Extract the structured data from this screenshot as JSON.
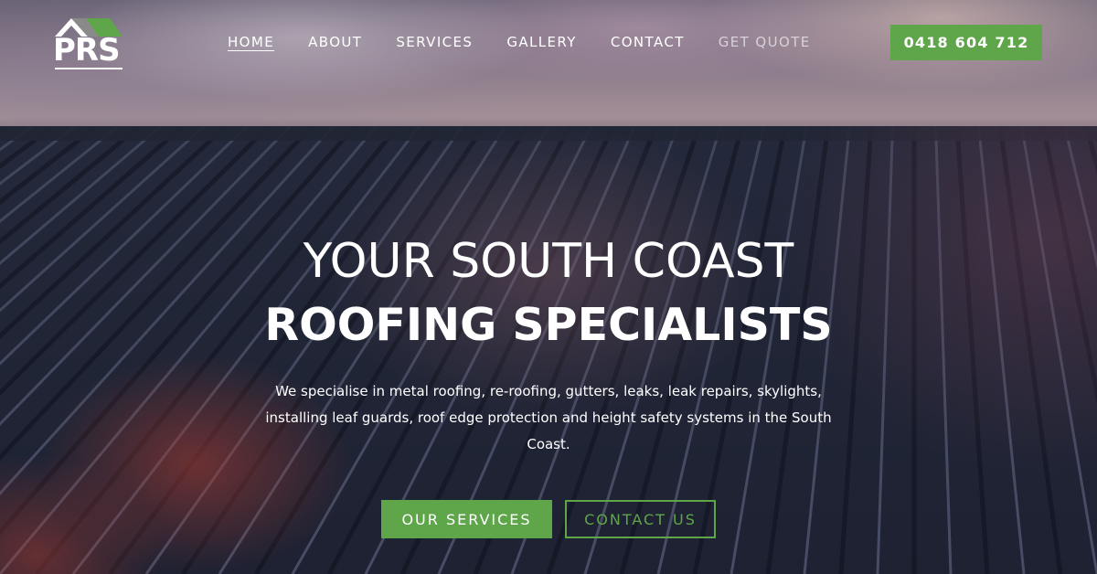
{
  "colors": {
    "brand_green": "#5fa64a",
    "logo_grey": "#6d6d6d",
    "text": "#ffffff"
  },
  "logo": {
    "text": "PRS",
    "icon": "roof-house-icon"
  },
  "nav": {
    "items": [
      {
        "label": "HOME",
        "active": true
      },
      {
        "label": "ABOUT",
        "active": false
      },
      {
        "label": "SERVICES",
        "active": false
      },
      {
        "label": "GALLERY",
        "active": false
      },
      {
        "label": "CONTACT",
        "active": false
      },
      {
        "label": "GET QUOTE",
        "active": false
      }
    ],
    "phone": "0418 604 712"
  },
  "hero": {
    "title_line_1": "YOUR SOUTH COAST",
    "title_line_2": "ROOFING SPECIALISTS",
    "description": "We specialise in metal roofing, re-roofing, gutters, leaks, leak repairs, skylights, installing leaf guards, roof edge protection and height safety systems in the South Coast.",
    "primary_button": "OUR SERVICES",
    "secondary_button": "CONTACT US"
  }
}
